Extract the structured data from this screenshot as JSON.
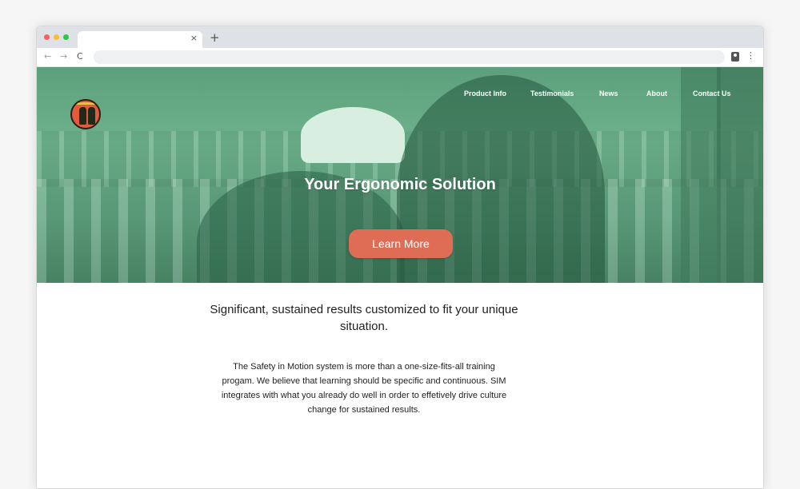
{
  "browser": {
    "tab_close": "×",
    "new_tab": "+",
    "back": "←",
    "forward": "→",
    "reload": "C",
    "address": "",
    "traffic_colors": [
      "#ff5f57",
      "#febc2e",
      "#28c840"
    ]
  },
  "site": {
    "nav": [
      {
        "label": "Product Info"
      },
      {
        "label": "Testimonials"
      },
      {
        "label": "News"
      },
      {
        "label": "About"
      },
      {
        "label": "Contact Us"
      }
    ],
    "hero": {
      "title": "Your Ergonomic Solution",
      "cta_label": "Learn More",
      "overlay_color": "#66ab85"
    },
    "subtitle": "Significant, sustained results customized to fit your unique situation.",
    "body": "The Safety in Motion system is more than a one-size-fits-all training progam. We believe that learning should be specific and continuous. SIM integrates with what you already do well in order to effetively drive culture change for sustained results.",
    "accent_color": "#df6d56"
  }
}
